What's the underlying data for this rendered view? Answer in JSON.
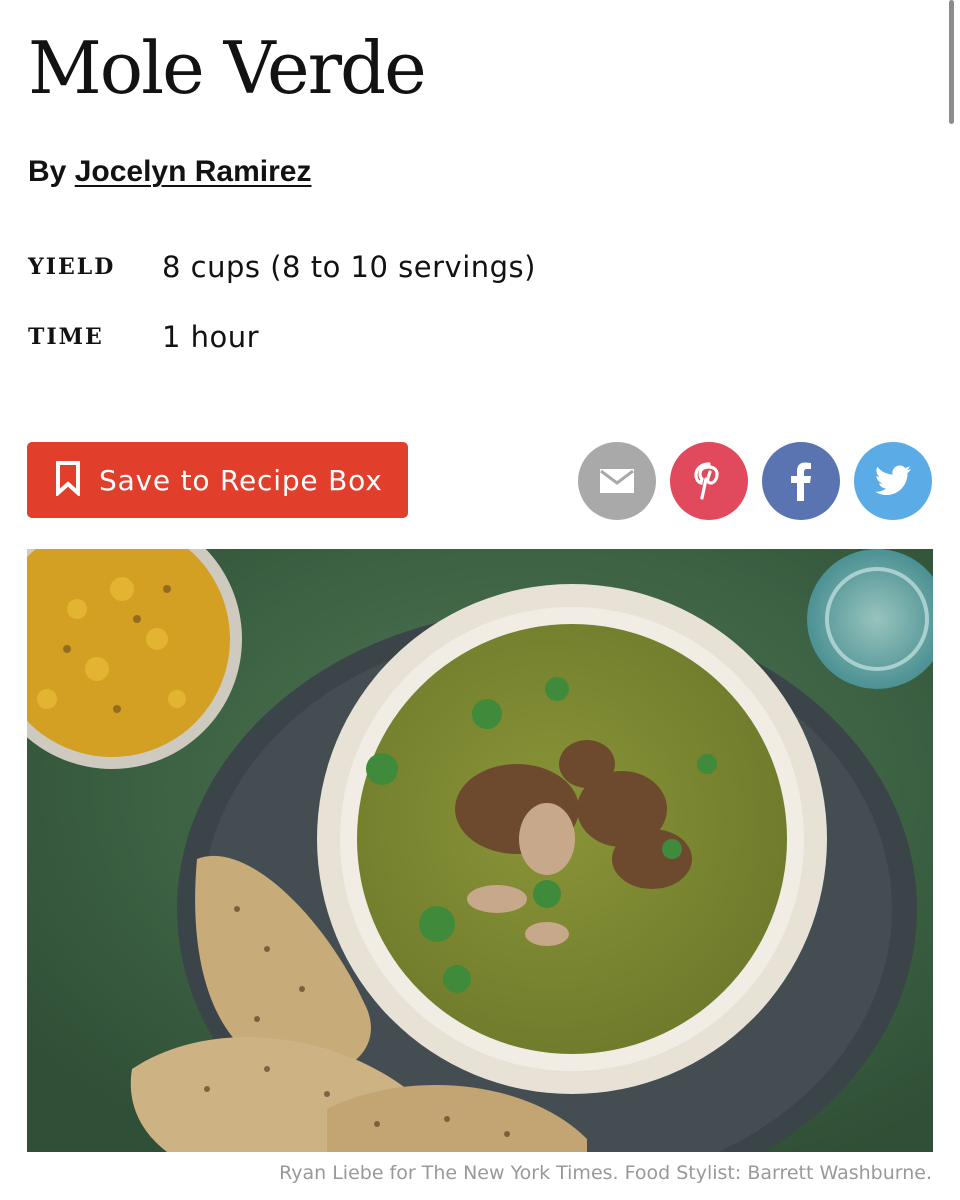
{
  "recipe": {
    "title": "Mole Verde",
    "byline_prefix": "By",
    "author": "Jocelyn Ramirez",
    "yield_label": "YIELD",
    "yield_value": "8 cups (8 to 10 servings)",
    "time_label": "TIME",
    "time_value": "1 hour"
  },
  "actions": {
    "save_label": "Save to Recipe Box",
    "share": [
      {
        "name": "email",
        "icon": "envelope-icon",
        "color": "#a9a9a9"
      },
      {
        "name": "pinterest",
        "icon": "pinterest-icon",
        "color": "#e14a5c"
      },
      {
        "name": "facebook",
        "icon": "facebook-icon",
        "color": "#5974b1"
      },
      {
        "name": "twitter",
        "icon": "twitter-bird-icon",
        "color": "#5aabe6"
      }
    ]
  },
  "photo": {
    "caption": "Ryan Liebe for The New York Times. Food Stylist: Barrett Washburne."
  },
  "colors": {
    "accent_red": "#e13f2b",
    "text": "#121212",
    "caption_gray": "#999999"
  }
}
